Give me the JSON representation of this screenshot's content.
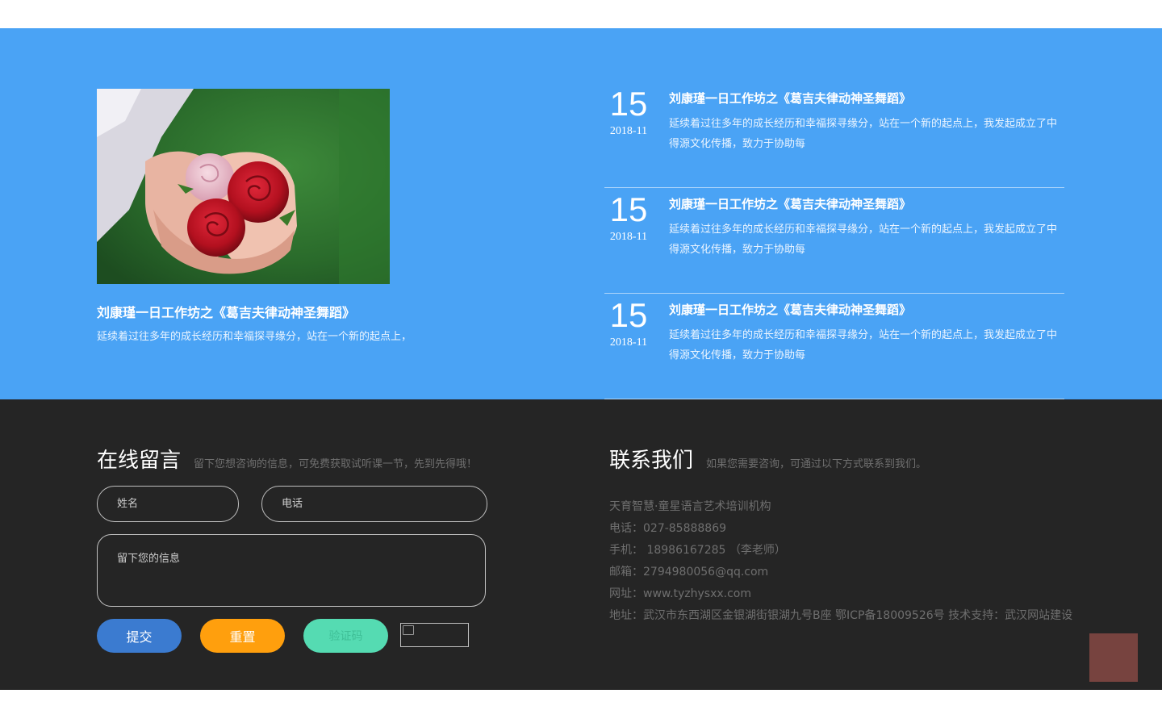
{
  "news": {
    "feature": {
      "title": "刘康瑾一日工作坊之《葛吉夫律动神圣舞蹈》",
      "desc": "延续着过往多年的成长经历和幸福探寻缘分，站在一个新的起点上，"
    },
    "items": [
      {
        "day": "15",
        "ym": "2018-11",
        "title": "刘康瑾一日工作坊之《葛吉夫律动神圣舞蹈》",
        "desc": "延续着过往多年的成长经历和幸福探寻缘分，站在一个新的起点上，我发起成立了中得源文化传播，致力于协助每"
      },
      {
        "day": "15",
        "ym": "2018-11",
        "title": "刘康瑾一日工作坊之《葛吉夫律动神圣舞蹈》",
        "desc": "延续着过往多年的成长经历和幸福探寻缘分，站在一个新的起点上，我发起成立了中得源文化传播，致力于协助每"
      },
      {
        "day": "15",
        "ym": "2018-11",
        "title": "刘康瑾一日工作坊之《葛吉夫律动神圣舞蹈》",
        "desc": "延续着过往多年的成长经历和幸福探寻缘分，站在一个新的起点上，我发起成立了中得源文化传播，致力于协助每"
      }
    ]
  },
  "message": {
    "heading": "在线留言",
    "subheading": "留下您想咨询的信息，可免费获取试听课一节，先到先得哦！",
    "name_placeholder": "姓名",
    "phone_placeholder": "电话",
    "msg_placeholder": "留下您的信息",
    "submit_label": "提交",
    "reset_label": "重置",
    "code_label": "验证码"
  },
  "contact": {
    "heading": "联系我们",
    "subheading": "如果您需要咨询，可通过以下方式联系到我们。",
    "lines": [
      "天育智慧·童星语言艺术培训机构",
      "电话：027-85888869",
      "手机： 18986167285 （李老师）",
      "邮箱：2794980056@qq.com",
      "网址：www.tyzhysxx.com",
      "地址：武汉市东西湖区金银湖街银湖九号B座 鄂ICP备18009526号 技术支持：武汉网站建设"
    ]
  },
  "colors": {
    "news_bg": "#4aa3f5",
    "footer_bg": "#252525",
    "submit": "#3b7bd0",
    "reset": "#ff9f0d",
    "code": "#55dbb2",
    "to_top": "#77433f"
  },
  "icons": {
    "captcha": "broken-image-icon"
  }
}
